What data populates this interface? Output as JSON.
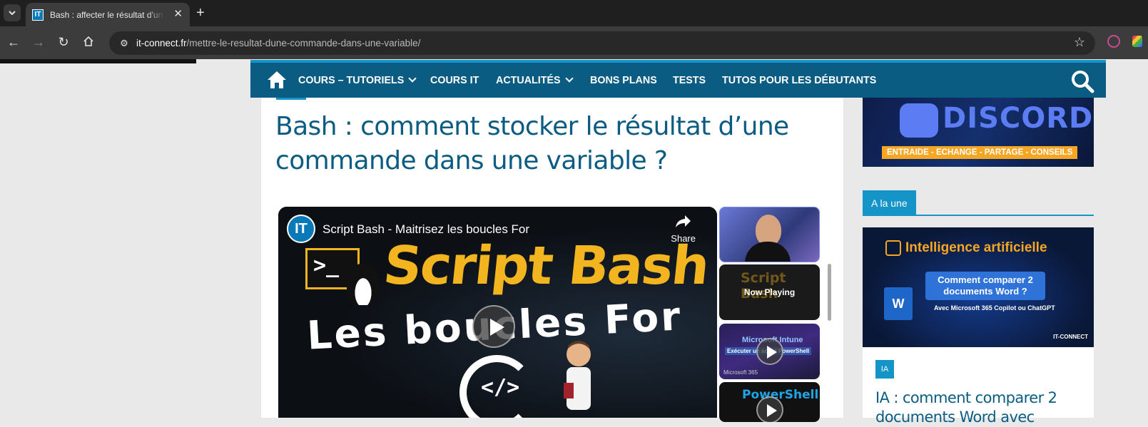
{
  "browser": {
    "tab_title": "Bash : affecter le résultat d'une commande dans une variable",
    "tab_favicon_text": "IT",
    "url_domain": "it-connect.fr",
    "url_path": "/mettre-le-resultat-dune-commande-dans-une-variable/"
  },
  "nav": {
    "items": [
      {
        "label": "COURS – TUTORIELS",
        "dropdown": true
      },
      {
        "label": "COURS IT",
        "dropdown": false
      },
      {
        "label": "ACTUALITÉS",
        "dropdown": true
      },
      {
        "label": "BONS PLANS",
        "dropdown": false
      },
      {
        "label": "TESTS",
        "dropdown": false
      },
      {
        "label": "TUTOS POUR LES DÉBUTANTS",
        "dropdown": false
      }
    ]
  },
  "article": {
    "title": "Bash : comment stocker le résultat d’une commande dans une variable ?"
  },
  "video": {
    "channel_avatar_text": "IT",
    "title": "Script Bash - Maitrisez les boucles For",
    "share_label": "Share",
    "thumb_title": "Script Bash",
    "thumb_subtitle": "Les boucles For",
    "terminal_glyph": ">_",
    "loop_glyph": "</>"
  },
  "playlist": {
    "now_playing": "Now Playing",
    "item2_ghost": "Script Bash",
    "item3_title": "Microsoft Intune",
    "item3_subtitle": "Exécuter un script PowerShell",
    "item3_brand": "Microsoft 365",
    "item4_title": "PowerShell"
  },
  "sidebar": {
    "discord_text": "DISCORD",
    "discord_tagline": "ENTRAIDE - ECHANGE - PARTAGE - CONSEILS",
    "section_label": "A la une",
    "feature": {
      "title": "Intelligence artificielle",
      "box": "Comment comparer 2 documents Word ?",
      "sub": "Avec Microsoft 365 Copilot ou ChatGPT",
      "word_glyph": "W",
      "brand": "IT-CONNECT"
    },
    "card_badge": "IA",
    "card_title": "IA : comment comparer 2 documents Word avec"
  },
  "colors": {
    "brand_dark": "#0b5c83",
    "brand_accent": "#1594c7",
    "thumb_yellow": "#f2b51f",
    "discord_orange": "#f5a623"
  },
  "icons": [
    "chevron-down-icon",
    "close-icon",
    "plus-icon",
    "back-icon",
    "forward-icon",
    "reload-icon",
    "home-icon",
    "site-info-icon",
    "star-icon",
    "extension-icon",
    "search-icon",
    "share-icon",
    "play-icon"
  ]
}
